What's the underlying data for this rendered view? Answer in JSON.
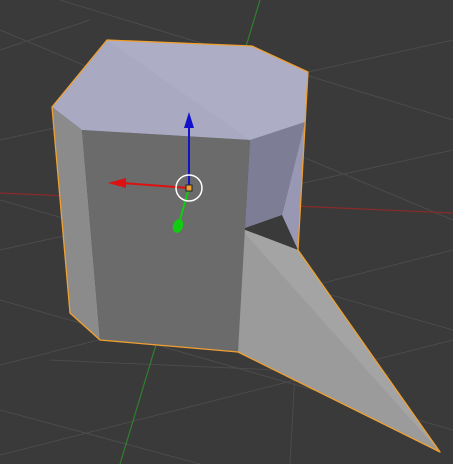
{
  "viewport": {
    "background_color": "#3a3a3a",
    "grid_color": "#4a4a4a",
    "x_axis_color": "#8a2a2a",
    "y_axis_color": "#2f7f2f"
  },
  "object": {
    "selected": true,
    "outline_color": "#f0a030",
    "face_colors": {
      "top": "#a9a9c1",
      "front": "#6a6a6a",
      "left_bevel": "#8c8c8c",
      "right_bevel": "#808098",
      "spike": "#999999"
    }
  },
  "gizmo": {
    "x_color": "#dd1111",
    "y_color": "#11cc11",
    "z_color": "#1111cc",
    "pivot_color": "#f0a030"
  }
}
